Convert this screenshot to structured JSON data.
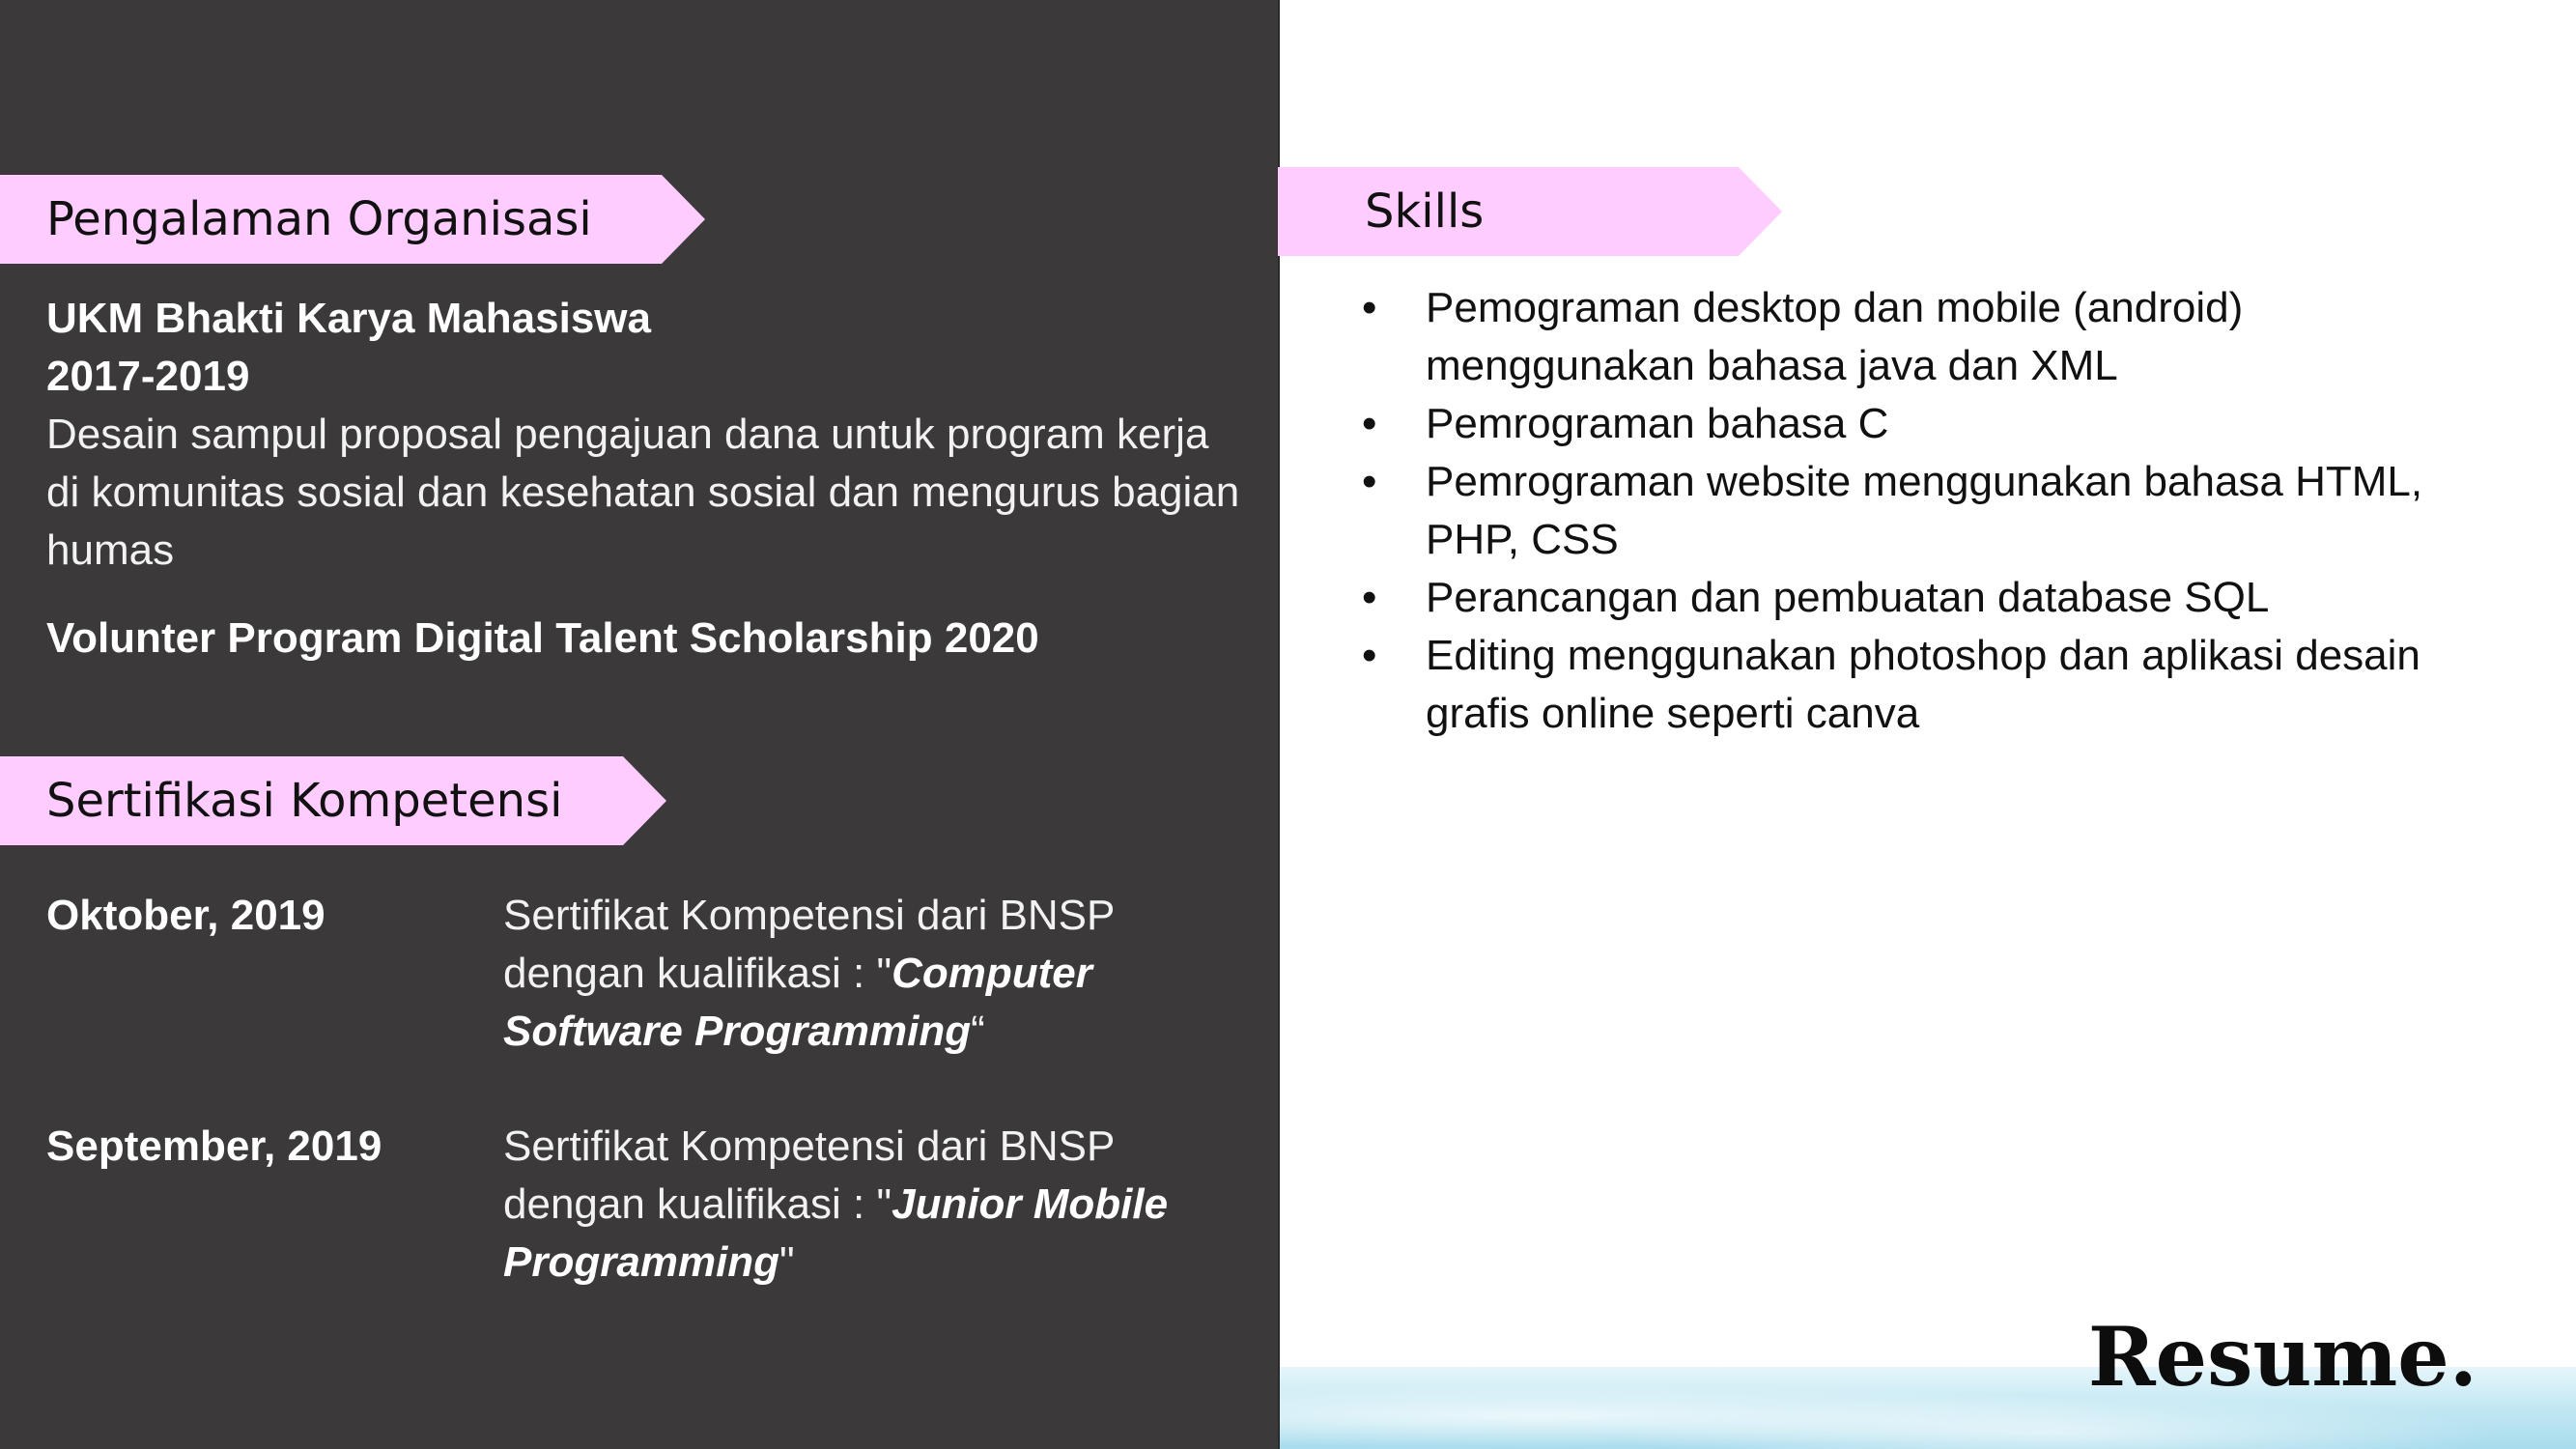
{
  "organization": {
    "heading": "Pengalaman Organisasi",
    "name": "UKM Bhakti Karya Mahasiswa",
    "period": "2017-2019",
    "description": "Desain sampul proposal pengajuan dana untuk program kerja di komunitas sosial dan kesehatan sosial dan mengurus bagian humas",
    "volunteer": "Volunter Program Digital Talent Scholarship 2020"
  },
  "certification": {
    "heading": "Sertifikasi Kompetensi",
    "items": [
      {
        "date": "Oktober, 2019",
        "text": "Sertifikat Kompetensi dari BNSP dengan kualifikasi : \"",
        "qualification": "Computer Software Programming",
        "closing": "“"
      },
      {
        "date": "September, 2019",
        "text": "Sertifikat Kompetensi dari BNSP dengan kualifikasi : \"",
        "qualification": "Junior Mobile Programming",
        "closing": "\""
      }
    ]
  },
  "skills": {
    "heading": "Skills",
    "items": [
      "Pemograman desktop dan mobile (android) menggunakan bahasa java dan XML",
      "Pemrograman bahasa C",
      "Pemrograman website menggunakan bahasa HTML, PHP, CSS",
      "Perancangan dan pembuatan database SQL",
      "Editing menggunakan photoshop dan aplikasi desain grafis online seperti canva"
    ]
  },
  "logo": {
    "text": "Resume."
  },
  "colors": {
    "panel": "#3b393a",
    "banner": "#ffccff",
    "text_light": "#ffffff",
    "text_dark": "#111111"
  }
}
